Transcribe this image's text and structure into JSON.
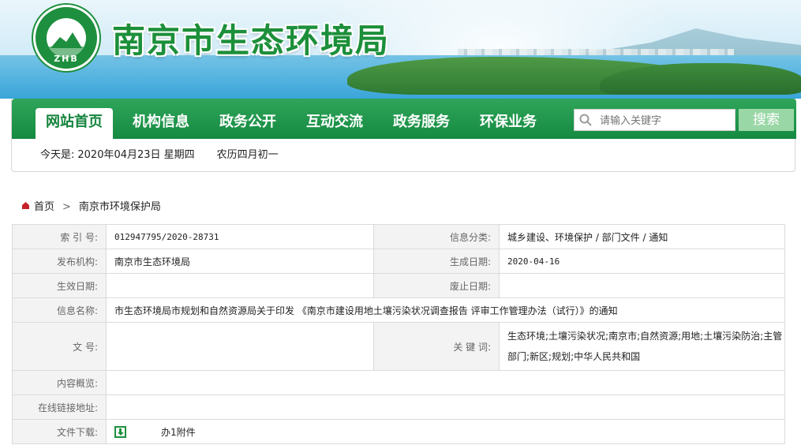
{
  "header": {
    "logo_text": "ZHB",
    "site_title": "南京市生态环境局"
  },
  "nav": {
    "items": [
      {
        "label": "网站首页",
        "active": true
      },
      {
        "label": "机构信息",
        "active": false
      },
      {
        "label": "政务公开",
        "active": false
      },
      {
        "label": "互动交流",
        "active": false
      },
      {
        "label": "政务服务",
        "active": false
      },
      {
        "label": "环保业务",
        "active": false
      }
    ],
    "search_placeholder": "请输入关键字",
    "search_button": "搜索"
  },
  "date_bar": {
    "prefix": "今天是:",
    "date": "2020年04月23日",
    "weekday": "星期四",
    "lunar": "农历四月初一"
  },
  "breadcrumb": {
    "home": "首页",
    "separator": ">",
    "current": "南京市环境保护局"
  },
  "info": {
    "index_label": "索 引 号:",
    "index_value": "012947795/2020-28731",
    "category_label": "信息分类:",
    "category_value": "城乡建设、环境保护 / 部门文件 / 通知",
    "publisher_label": "发布机构:",
    "publisher_value": "南京市生态环境局",
    "created_label": "生成日期:",
    "created_value": "2020-04-16",
    "effective_label": "生效日期:",
    "effective_value": "",
    "abolish_label": "废止日期:",
    "abolish_value": "",
    "name_label": "信息名称:",
    "name_value": "市生态环境局市规划和自然资源局关于印发 《南京市建设用地土壤污染状况调查报告 评审工作管理办法（试行）》的通知",
    "doc_no_label": "文      号:",
    "doc_no_value": "",
    "keywords_label": "关 键 词:",
    "keywords_value": "生态环境;土壤污染状况;南京市;自然资源;用地;土壤污染防治;主管部门;新区;规划;中华人民共和国",
    "overview_label": "内容概览:",
    "overview_value": "",
    "link_label": "在线链接地址:",
    "link_value": "",
    "download_label": "文件下载:",
    "download_value": "办1附件"
  },
  "colors": {
    "brand_green": "#1e8f3e",
    "nav_green": "#158a41",
    "search_button_bg": "#9ad7a6"
  }
}
